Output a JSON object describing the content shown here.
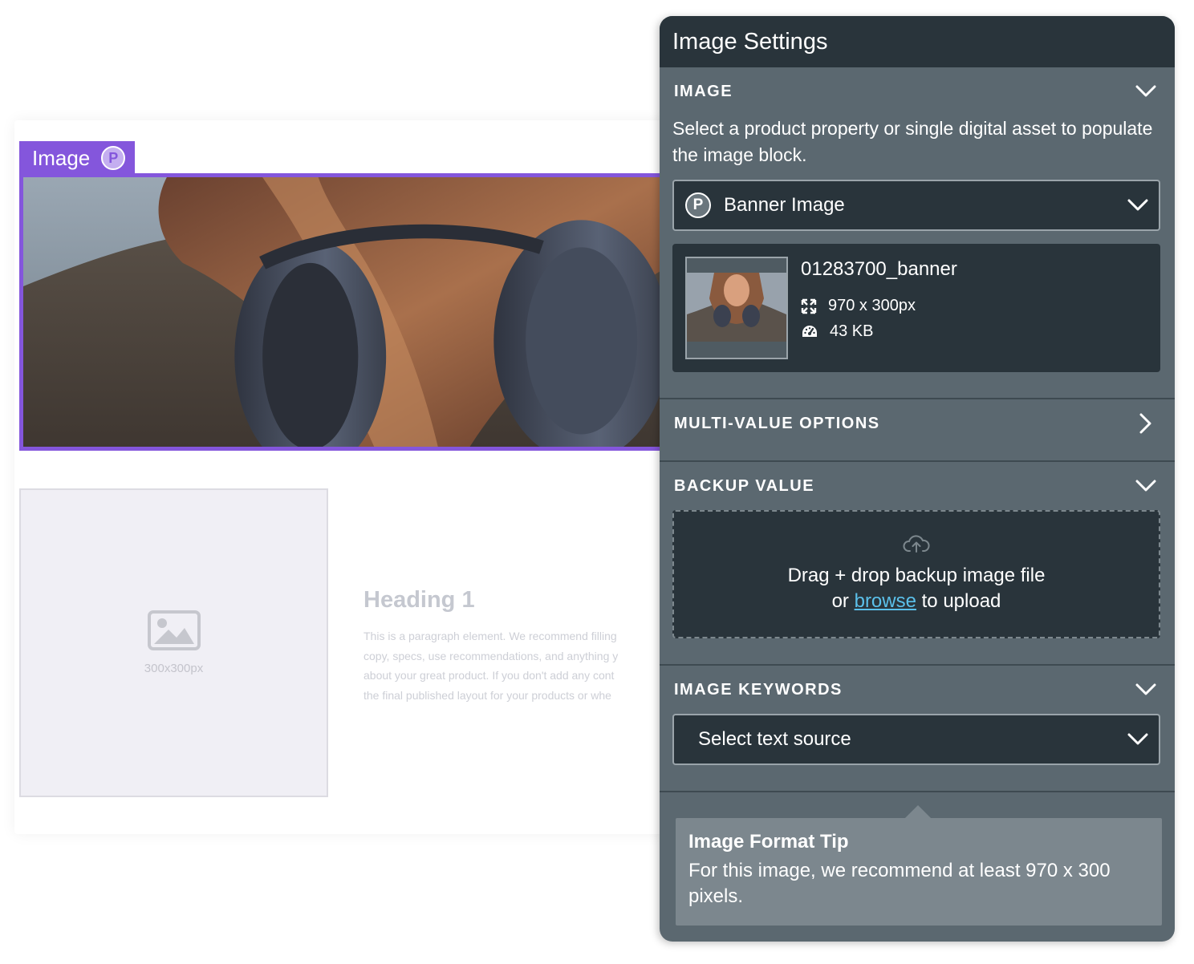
{
  "canvas": {
    "image_block": {
      "tag_label": "Image",
      "tag_badge": "P"
    },
    "placeholder": {
      "size_label": "300x300px"
    },
    "heading": "Heading 1",
    "paragraph_lines": [
      "This is a paragraph element. We recommend filling",
      "copy, specs, use recommendations, and anything y",
      "about your great product. If you don't add any cont",
      "the final published layout for your products or whe"
    ]
  },
  "panel": {
    "title": "Image Settings",
    "image_section": {
      "label": "IMAGE",
      "description": "Select a product property or single digital asset to populate the image block.",
      "source_badge": "P",
      "source_value": "Banner Image",
      "asset": {
        "name": "01283700_banner",
        "dimensions": "970 x 300px",
        "file_size": "43 KB"
      }
    },
    "multi_value": {
      "label": "MULTI-VALUE OPTIONS"
    },
    "backup_value": {
      "label": "BACKUP VALUE",
      "drop_line1": "Drag + drop backup image file",
      "drop_or": "or",
      "browse": "browse",
      "drop_suffix": "to upload"
    },
    "keywords": {
      "label": "IMAGE KEYWORDS",
      "select_placeholder": "Select text source"
    },
    "tip": {
      "title": "Image Format Tip",
      "text": "For this image, we recommend at least 970 x 300 pixels."
    }
  },
  "colors": {
    "accent_purple": "#8456dc",
    "panel_bg": "#5b6870",
    "panel_dark": "#29343b",
    "link": "#5bc0ea"
  }
}
